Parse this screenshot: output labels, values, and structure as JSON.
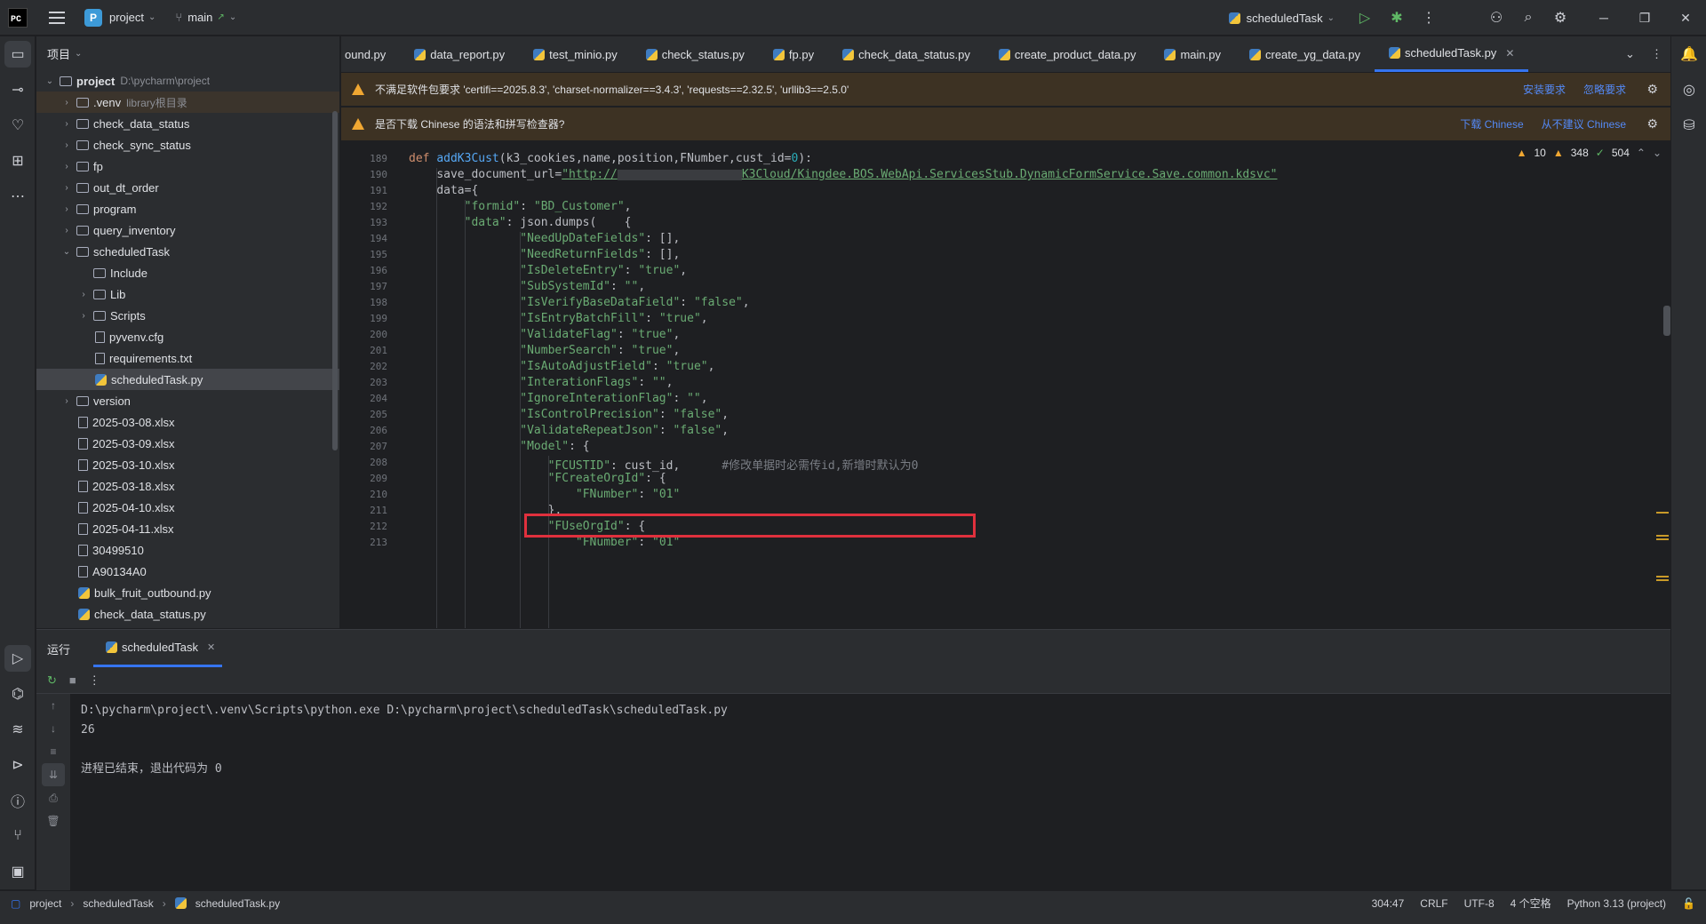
{
  "titlebar": {
    "logo": "PC",
    "project_badge": "P",
    "project_name": "project",
    "branch": "main",
    "run_config": "scheduledTask"
  },
  "project_panel": {
    "header": "项目",
    "root_name": "project",
    "root_path": "D:\\pycharm\\project",
    "items": [
      {
        "label": "project",
        "note": "D:\\pycharm\\project",
        "type": "folder",
        "depth": 0,
        "open": true
      },
      {
        "label": ".venv",
        "note": "library根目录",
        "type": "folder",
        "depth": 1,
        "open": false
      },
      {
        "label": "check_data_status",
        "type": "folder",
        "depth": 1,
        "open": false
      },
      {
        "label": "check_sync_status",
        "type": "folder",
        "depth": 1,
        "open": false
      },
      {
        "label": "fp",
        "type": "folder",
        "depth": 1,
        "open": false
      },
      {
        "label": "out_dt_order",
        "type": "folder",
        "depth": 1,
        "open": false
      },
      {
        "label": "program",
        "type": "folder",
        "depth": 1,
        "open": false
      },
      {
        "label": "query_inventory",
        "type": "folder",
        "depth": 1,
        "open": false
      },
      {
        "label": "scheduledTask",
        "type": "folder",
        "depth": 1,
        "open": true
      },
      {
        "label": "Include",
        "type": "folder-leaf",
        "depth": 2
      },
      {
        "label": "Lib",
        "type": "folder",
        "depth": 2,
        "open": false
      },
      {
        "label": "Scripts",
        "type": "folder",
        "depth": 2,
        "open": false
      },
      {
        "label": "pyvenv.cfg",
        "type": "file",
        "depth": 2
      },
      {
        "label": "requirements.txt",
        "type": "file",
        "depth": 2
      },
      {
        "label": "scheduledTask.py",
        "type": "py",
        "depth": 2
      },
      {
        "label": "version",
        "type": "folder",
        "depth": 1,
        "open": false
      },
      {
        "label": "2025-03-08.xlsx",
        "type": "file",
        "depth": 1
      },
      {
        "label": "2025-03-09.xlsx",
        "type": "file",
        "depth": 1
      },
      {
        "label": "2025-03-10.xlsx",
        "type": "file",
        "depth": 1
      },
      {
        "label": "2025-03-18.xlsx",
        "type": "file",
        "depth": 1
      },
      {
        "label": "2025-04-10.xlsx",
        "type": "file",
        "depth": 1
      },
      {
        "label": "2025-04-11.xlsx",
        "type": "file",
        "depth": 1
      },
      {
        "label": "30499510",
        "type": "file",
        "depth": 1
      },
      {
        "label": "A90134A0",
        "type": "file",
        "depth": 1
      },
      {
        "label": "bulk_fruit_outbound.py",
        "type": "py",
        "depth": 1
      },
      {
        "label": "check_data_status.py",
        "type": "py",
        "depth": 1
      }
    ]
  },
  "tabs": [
    {
      "label": "ound.py"
    },
    {
      "label": "data_report.py"
    },
    {
      "label": "test_minio.py"
    },
    {
      "label": "check_status.py"
    },
    {
      "label": "fp.py"
    },
    {
      "label": "check_data_status.py"
    },
    {
      "label": "create_product_data.py"
    },
    {
      "label": "main.py"
    },
    {
      "label": "create_yg_data.py"
    },
    {
      "label": "scheduledTask.py"
    }
  ],
  "notifications": {
    "requirements": {
      "text": "不满足软件包要求 'certifi==2025.8.3', 'charset-normalizer==3.4.3', 'requests==2.32.5', 'urllib3==2.5.0'",
      "action1": "安装要求",
      "action2": "忽略要求"
    },
    "grammar": {
      "text": "是否下载 Chinese 的语法和拼写检查器?",
      "action1": "下载 Chinese",
      "action2": "从不建议 Chinese"
    }
  },
  "editor": {
    "inspections": {
      "warnings": "10",
      "weak_warnings": "348",
      "ok": "504"
    },
    "lines": [
      {
        "n": "189",
        "indent": 0,
        "parts": [
          [
            "kw",
            "def "
          ],
          [
            "fn",
            "addK3Cust"
          ],
          [
            "pm",
            "(k3_cookies,name,position,FNumber,cust_id="
          ],
          [
            "nm",
            "0"
          ],
          [
            "pm",
            "):"
          ]
        ]
      },
      {
        "n": "190",
        "indent": 1,
        "parts": [
          [
            "pm",
            "save_document_url="
          ],
          [
            "url",
            "\"http://"
          ],
          [
            "redact",
            ""
          ],
          [
            "url",
            "K3Cloud/Kingdee.BOS.WebApi.ServicesStub.DynamicFormService.Save.common.kdsvc\""
          ]
        ]
      },
      {
        "n": "191",
        "indent": 1,
        "parts": [
          [
            "pm",
            "data={"
          ]
        ]
      },
      {
        "n": "192",
        "indent": 2,
        "parts": [
          [
            "st",
            "\"formid\""
          ],
          [
            "pm",
            ": "
          ],
          [
            "st",
            "\"BD_Customer\""
          ],
          [
            "pm",
            ","
          ]
        ]
      },
      {
        "n": "193",
        "indent": 2,
        "parts": [
          [
            "st",
            "\"data\""
          ],
          [
            "pm",
            ": json.dumps(    {"
          ]
        ]
      },
      {
        "n": "194",
        "indent": 4,
        "parts": [
          [
            "st",
            "\"NeedUpDateFields\""
          ],
          [
            "pm",
            ": [],"
          ]
        ]
      },
      {
        "n": "195",
        "indent": 4,
        "parts": [
          [
            "st",
            "\"NeedReturnFields\""
          ],
          [
            "pm",
            ": [],"
          ]
        ]
      },
      {
        "n": "196",
        "indent": 4,
        "parts": [
          [
            "st",
            "\"IsDeleteEntry\""
          ],
          [
            "pm",
            ": "
          ],
          [
            "st",
            "\"true\""
          ],
          [
            "pm",
            ","
          ]
        ]
      },
      {
        "n": "197",
        "indent": 4,
        "parts": [
          [
            "st",
            "\"SubSystemId\""
          ],
          [
            "pm",
            ": "
          ],
          [
            "st",
            "\"\""
          ],
          [
            "pm",
            ","
          ]
        ]
      },
      {
        "n": "198",
        "indent": 4,
        "parts": [
          [
            "st",
            "\"IsVerifyBaseDataField\""
          ],
          [
            "pm",
            ": "
          ],
          [
            "st",
            "\"false\""
          ],
          [
            "pm",
            ","
          ]
        ]
      },
      {
        "n": "199",
        "indent": 4,
        "parts": [
          [
            "st",
            "\"IsEntryBatchFill\""
          ],
          [
            "pm",
            ": "
          ],
          [
            "st",
            "\"true\""
          ],
          [
            "pm",
            ","
          ]
        ]
      },
      {
        "n": "200",
        "indent": 4,
        "parts": [
          [
            "st",
            "\"ValidateFlag\""
          ],
          [
            "pm",
            ": "
          ],
          [
            "st",
            "\"true\""
          ],
          [
            "pm",
            ","
          ]
        ]
      },
      {
        "n": "201",
        "indent": 4,
        "parts": [
          [
            "st",
            "\"NumberSearch\""
          ],
          [
            "pm",
            ": "
          ],
          [
            "st",
            "\"true\""
          ],
          [
            "pm",
            ","
          ]
        ]
      },
      {
        "n": "202",
        "indent": 4,
        "parts": [
          [
            "st",
            "\"IsAutoAdjustField\""
          ],
          [
            "pm",
            ": "
          ],
          [
            "st",
            "\"true\""
          ],
          [
            "pm",
            ","
          ]
        ]
      },
      {
        "n": "203",
        "indent": 4,
        "parts": [
          [
            "st",
            "\"InterationFlags\""
          ],
          [
            "pm",
            ": "
          ],
          [
            "st",
            "\"\""
          ],
          [
            "pm",
            ","
          ]
        ]
      },
      {
        "n": "204",
        "indent": 4,
        "parts": [
          [
            "st",
            "\"IgnoreInterationFlag\""
          ],
          [
            "pm",
            ": "
          ],
          [
            "st",
            "\"\""
          ],
          [
            "pm",
            ","
          ]
        ]
      },
      {
        "n": "205",
        "indent": 4,
        "parts": [
          [
            "st",
            "\"IsControlPrecision\""
          ],
          [
            "pm",
            ": "
          ],
          [
            "st",
            "\"false\""
          ],
          [
            "pm",
            ","
          ]
        ]
      },
      {
        "n": "206",
        "indent": 4,
        "parts": [
          [
            "st",
            "\"ValidateRepeatJson\""
          ],
          [
            "pm",
            ": "
          ],
          [
            "st",
            "\"false\""
          ],
          [
            "pm",
            ","
          ]
        ]
      },
      {
        "n": "207",
        "indent": 4,
        "parts": [
          [
            "st",
            "\"Model\""
          ],
          [
            "pm",
            ": {"
          ]
        ]
      },
      {
        "n": "208",
        "indent": 5,
        "parts": [
          [
            "st",
            "\"FCUSTID\""
          ],
          [
            "pm",
            ": cust_id,      "
          ],
          [
            "cm",
            "#修改单据时必需传id,新增时默认为0"
          ]
        ]
      },
      {
        "n": "209",
        "indent": 5,
        "parts": [
          [
            "st",
            "\"FCreateOrgId\""
          ],
          [
            "pm",
            ": {"
          ]
        ]
      },
      {
        "n": "210",
        "indent": 6,
        "parts": [
          [
            "st",
            "\"FNumber\""
          ],
          [
            "pm",
            ": "
          ],
          [
            "st",
            "\"01\""
          ]
        ]
      },
      {
        "n": "211",
        "indent": 5,
        "parts": [
          [
            "pm",
            "},"
          ]
        ]
      },
      {
        "n": "212",
        "indent": 5,
        "parts": [
          [
            "st",
            "\"FUseOrgId\""
          ],
          [
            "pm",
            ": {"
          ]
        ]
      },
      {
        "n": "213",
        "indent": 6,
        "parts": [
          [
            "st",
            "\"FNumber\""
          ],
          [
            "pm",
            ": "
          ],
          [
            "st",
            "\"01\""
          ]
        ]
      }
    ]
  },
  "run_panel": {
    "title": "运行",
    "tab": "scheduledTask",
    "console_lines": [
      "D:\\pycharm\\project\\.venv\\Scripts\\python.exe D:\\pycharm\\project\\scheduledTask\\scheduledTask.py",
      "26",
      "",
      "进程已结束，退出代码为 0"
    ]
  },
  "statusbar": {
    "crumbs": [
      "project",
      "scheduledTask",
      "scheduledTask.py"
    ],
    "position": "304:47",
    "line_sep": "CRLF",
    "encoding": "UTF-8",
    "indent": "4 个空格",
    "interpreter": "Python 3.13 (project)"
  }
}
